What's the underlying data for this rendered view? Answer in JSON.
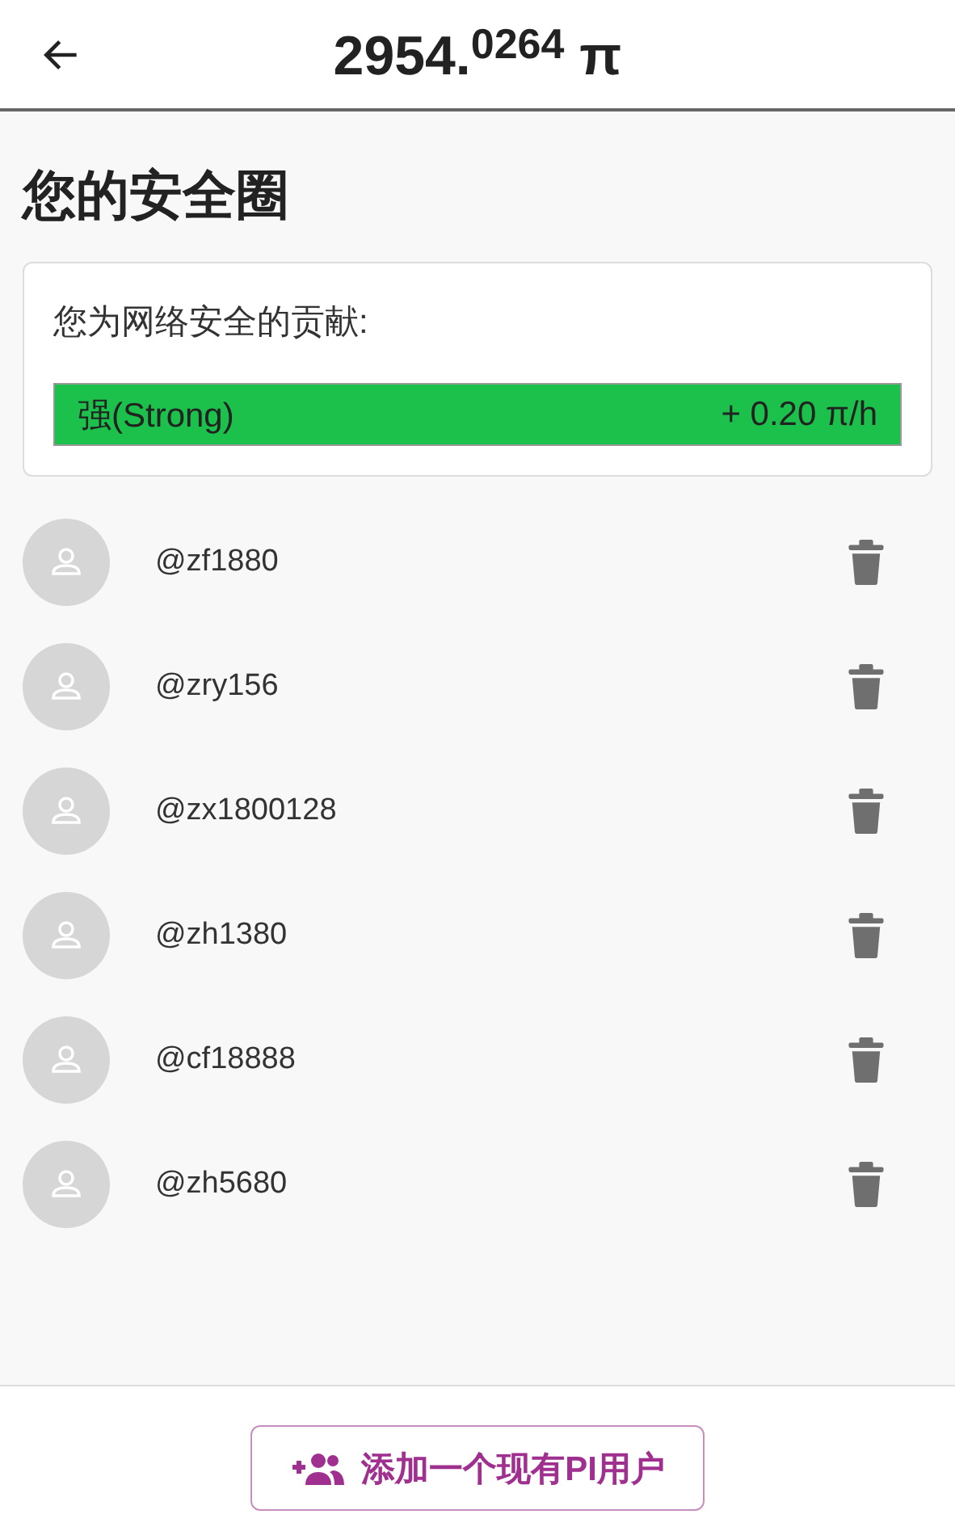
{
  "header": {
    "balance": "2954.$^{0264}$ π"
  },
  "title": "您的安全圈",
  "contribution": {
    "label": "您为网络安全的贡献:",
    "strength": "强(Strong)",
    "rate": "+ 0.20 π/h",
    "level": 1
  },
  "members": [
    {
      "username": "@zf1880"
    },
    {
      "username": "@zry156"
    },
    {
      "username": "@zx1800128"
    },
    {
      "username": "@zh1380"
    },
    {
      "username": "@cf18888"
    },
    {
      "username": "@zh5680"
    }
  ],
  "add_button": {
    "label": "添加一个现有PI用户"
  }
}
